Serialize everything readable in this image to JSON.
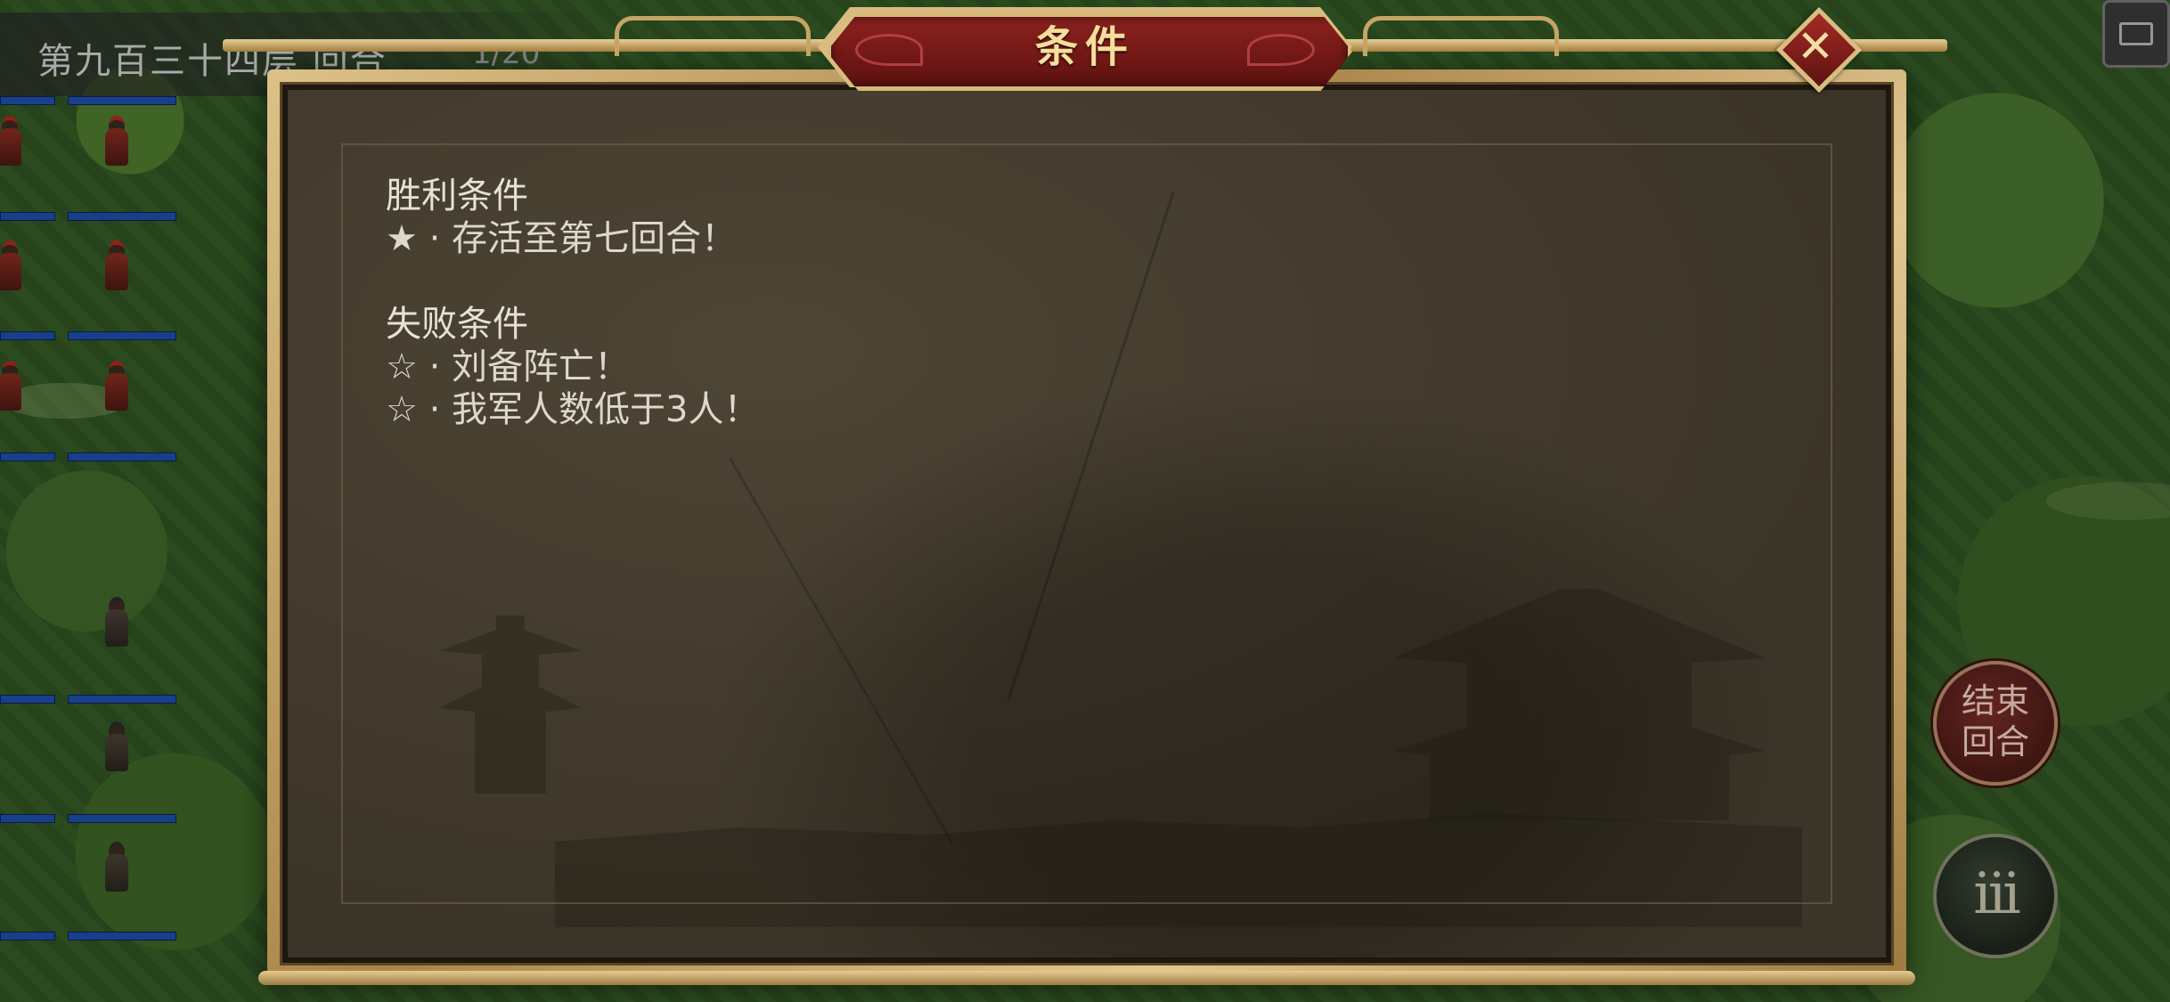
{
  "hud": {
    "turn_label": "第九百三十四层 回合",
    "turn_count": "1/20",
    "end_turn_line1": "结束",
    "end_turn_line2": "回合",
    "menu_label": "iii"
  },
  "dialog": {
    "title": "条件",
    "close_symbol": "✕",
    "victory_heading": "胜利条件",
    "victory_items": [
      "★ · 存活至第七回合！"
    ],
    "defeat_heading": "失败条件",
    "defeat_items": [
      "☆ · 刘备阵亡！",
      "☆ · 我军人数低于3人！"
    ]
  },
  "colors": {
    "title_plaque": "#8c211e",
    "frame_gold": "#d9bd80",
    "panel_bg": "#3b3428",
    "text": "#ddd8cc",
    "hp_bar": "#1e4da8"
  }
}
